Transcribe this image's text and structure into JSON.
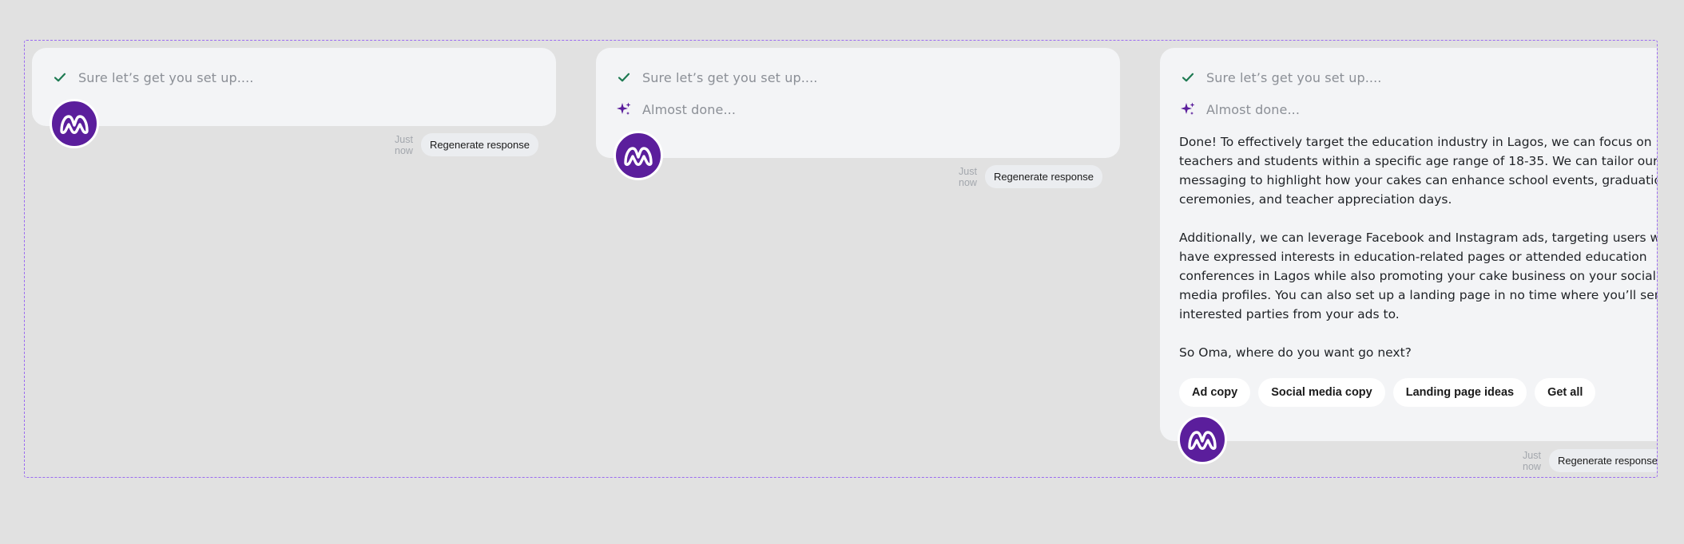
{
  "colors": {
    "background": "#e1e1e1",
    "card": "#f3f4f6",
    "brand_purple": "#5b1e9c",
    "check_green": "#1e7a52",
    "dashed_border": "#9b6cf0"
  },
  "status": {
    "setup": "Sure let’s get you set up....",
    "almost": "Almost done..."
  },
  "response": {
    "p1": "Done! To effectively target the education industry in Lagos, we can focus on teachers and students within a specific age range of 18-35. We can tailor our messaging to highlight how your cakes can enhance school events, graduation ceremonies, and teacher appreciation days.",
    "p2": "Additionally, we can leverage Facebook and Instagram ads, targeting users who have expressed interests in education-related pages or attended education conferences in Lagos while also promoting your cake business on your social media profiles. You can also set up a landing page in no time where you’ll send interested parties from your ads to.",
    "p3": "So Oma, where do you want go next?"
  },
  "chips": [
    "Ad copy",
    "Social media copy",
    "Landing page ideas",
    "Get all"
  ],
  "meta": {
    "timestamp": "Just now",
    "regenerate": "Regenerate response"
  },
  "icons": {
    "check": "check-icon",
    "sparkle": "sparkle-icon",
    "avatar": "brand-logo-avatar"
  }
}
